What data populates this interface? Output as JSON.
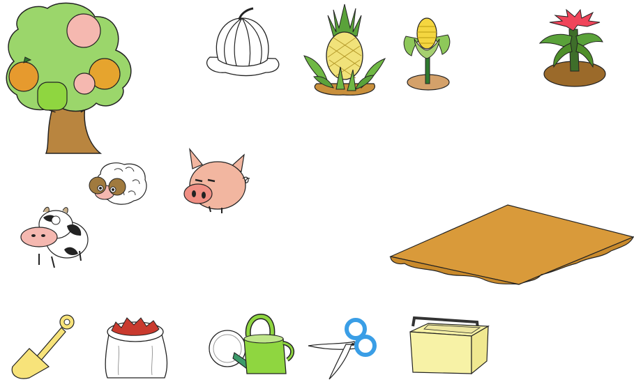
{
  "scene": {
    "name": "farm-game-board",
    "background": "#ffffff"
  },
  "plants": [
    {
      "id": "fruit-tree",
      "icon": "fruit-tree-icon",
      "fruits": [
        "pink-peach",
        "orange",
        "green-apple",
        "pink-peach",
        "orange"
      ]
    },
    {
      "id": "pumpkin",
      "icon": "pumpkin-outline-icon",
      "state": "uncolored"
    },
    {
      "id": "pineapple",
      "icon": "pineapple-plant-icon"
    },
    {
      "id": "corn",
      "icon": "corn-plant-icon"
    },
    {
      "id": "flower",
      "icon": "red-flower-plant-icon"
    }
  ],
  "animals": [
    {
      "id": "sheep",
      "icon": "sheep-icon"
    },
    {
      "id": "pig",
      "icon": "pig-icon"
    },
    {
      "id": "cow",
      "icon": "cow-icon"
    }
  ],
  "field": {
    "id": "soil-plot",
    "icon": "soil-plot-icon"
  },
  "tools": [
    {
      "id": "shovel",
      "icon": "shovel-icon"
    },
    {
      "id": "seed-bag",
      "icon": "seed-bag-icon"
    },
    {
      "id": "watering-can",
      "icon": "watering-can-icon"
    },
    {
      "id": "scissors",
      "icon": "scissors-icon"
    },
    {
      "id": "basket",
      "icon": "basket-icon"
    }
  ],
  "colors": {
    "leaf_green": "#9bd66b",
    "dark_green": "#4f8f2a",
    "trunk_brown": "#b9853f",
    "soil_brown": "#d99a3a",
    "pig_pink": "#f2b6a0",
    "accent_yellow": "#f7e37a",
    "accent_blue": "#3a9ee6",
    "flower_red": "#f0455a"
  }
}
